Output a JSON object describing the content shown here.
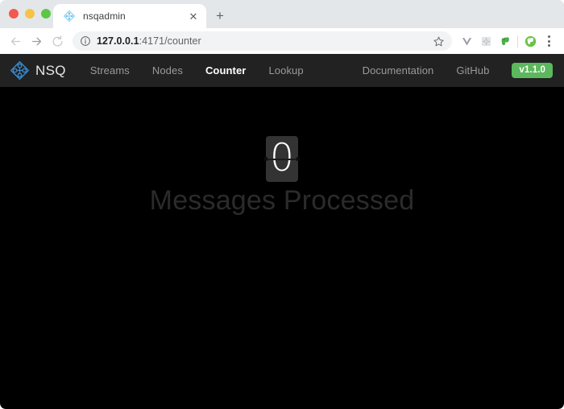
{
  "browser": {
    "traffic_lights": [
      "close",
      "minimize",
      "maximize"
    ],
    "tab": {
      "title": "nsqadmin",
      "favicon": "nsq-diamond-icon",
      "close_label": "✕"
    },
    "new_tab_label": "+",
    "nav": {
      "back": "back-arrow",
      "forward": "forward-arrow",
      "reload": "reload-arrow"
    },
    "omnibox": {
      "info_icon": "info-circle-icon",
      "host": "127.0.0.1",
      "path": ":4171/counter",
      "star_icon": "bookmark-star-icon"
    },
    "extensions": [
      {
        "name": "vuejs-devtools-icon",
        "color": "#8e8e8e"
      },
      {
        "name": "puzzle-extensions-icon",
        "color": "#c8c8c8"
      },
      {
        "name": "evernote-clipper-icon",
        "color": "#4cae4c"
      },
      {
        "name": "evernote-profile-icon",
        "color": "#6cc24a"
      }
    ],
    "menu_label": "chrome-menu-icon"
  },
  "app": {
    "brand": {
      "logo": "nsq-logo-icon",
      "name": "NSQ",
      "accent": "#3b8fd4"
    },
    "nav_links": [
      {
        "label": "Streams",
        "active": false
      },
      {
        "label": "Nodes",
        "active": false
      },
      {
        "label": "Counter",
        "active": true
      },
      {
        "label": "Lookup",
        "active": false
      }
    ],
    "nav_right": [
      {
        "label": "Documentation"
      },
      {
        "label": "GitHub"
      }
    ],
    "version": {
      "label": "v1.1.0",
      "color": "#5cb85c"
    },
    "counter": {
      "digits": [
        "0"
      ],
      "label": "Messages Processed",
      "label_color": "#2b2b2b",
      "background": "#000000"
    }
  }
}
